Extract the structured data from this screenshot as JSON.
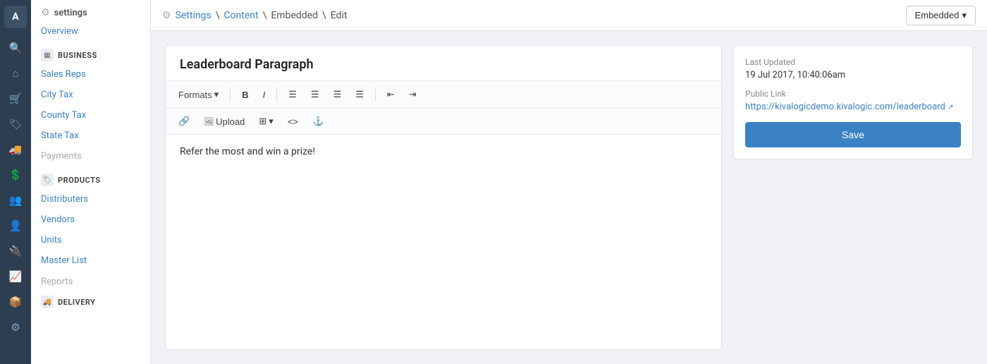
{
  "app": {
    "logo_text": "A"
  },
  "icon_nav": {
    "icons": [
      {
        "name": "search-icon",
        "glyph": "🔍"
      },
      {
        "name": "home-icon",
        "glyph": "⌂"
      },
      {
        "name": "orders-icon",
        "glyph": "🛒"
      },
      {
        "name": "tag-icon",
        "glyph": "🏷"
      },
      {
        "name": "truck-icon",
        "glyph": "🚚"
      },
      {
        "name": "dollar-icon",
        "glyph": "💲"
      },
      {
        "name": "people-icon",
        "glyph": "👥"
      },
      {
        "name": "users-icon",
        "glyph": "👤"
      },
      {
        "name": "puzzle-icon",
        "glyph": "🔌"
      },
      {
        "name": "chart-icon",
        "glyph": "📈"
      },
      {
        "name": "delivery-icon",
        "glyph": "📦"
      },
      {
        "name": "settings-icon",
        "glyph": "⚙"
      }
    ]
  },
  "left_nav": {
    "settings_label": "settings",
    "overview_label": "Overview",
    "business_section": "BUSINESS",
    "sales_reps_label": "Sales Reps",
    "city_tax_label": "City Tax",
    "county_tax_label": "County Tax",
    "state_tax_label": "State Tax",
    "payments_label": "Payments",
    "products_section": "PRODUCTS",
    "distributers_label": "Distributers",
    "vendors_label": "Vendors",
    "units_label": "Units",
    "master_list_label": "Master List",
    "reports_label": "Reports",
    "delivery_section": "DELIVERY"
  },
  "topbar": {
    "gear_icon": "⚙",
    "settings_link": "Settings",
    "content_link": "Content",
    "embedded_label": "Embedded",
    "edit_label": "Edit",
    "breadcrumb_sep": "\\",
    "embedded_btn_label": "Embedded",
    "chevron_down": "▾"
  },
  "editor": {
    "title": "Leaderboard Paragraph",
    "formats_label": "Formats",
    "formats_arrow": "▾",
    "bold_label": "B",
    "italic_label": "I",
    "align_left": "≡",
    "align_center": "≡",
    "align_right": "≡",
    "align_justify": "≡",
    "indent_left": "⇤",
    "indent_right": "⇥",
    "link_icon": "🔗",
    "upload_label": "Upload",
    "image_icon": "🖼",
    "table_label": "⊞",
    "code_label": "<>",
    "anchor_label": "⚓",
    "body_text": "Refer the most and win a prize!"
  },
  "side_panel": {
    "last_updated_label": "Last Updated",
    "last_updated_value": "19 Jul 2017, 10:40:06am",
    "public_link_label": "Public Link",
    "public_link_text": "https://kivalogicdemo.kivalogic.com/leaderboard",
    "public_link_icon": "↗",
    "save_label": "Save"
  }
}
